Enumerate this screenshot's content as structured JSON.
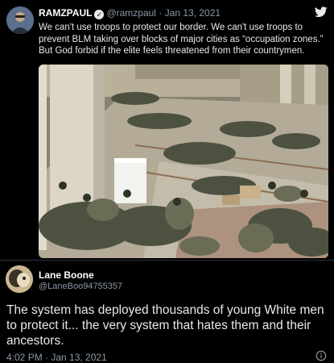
{
  "quoted": {
    "name": "RAMZPAUL",
    "handle": "@ramzpaul",
    "separator": "·",
    "date": "Jan 13, 2021",
    "text": "We can't use troops to protect our border. We can't use troops to prevent BLM taking over blocks of major cities as “occupation zones.” But God forbid if the elite feels threatened from their countrymen."
  },
  "tweet": {
    "name": "Lane Boone",
    "handle": "@LaneBoo94755357",
    "text": "The system has deployed thousands of young White men to protect it... the very system that hates them and their ancestors.",
    "timestamp": "4:02 PM · Jan 13, 2021"
  },
  "icons": {
    "verified": "verified-badge-icon",
    "brand": "twitter-bird-icon",
    "info": "info-icon"
  },
  "colors": {
    "background": "#000000",
    "text": "#e7e9ea",
    "secondary": "#8b98a5"
  }
}
